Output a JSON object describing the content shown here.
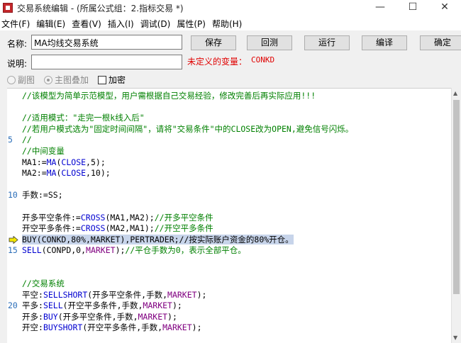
{
  "window": {
    "title": "交易系统编辑 - (所属公式组：2.指标交易 *)",
    "minimize_glyph": "—",
    "maximize_glyph": "☐",
    "close_glyph": "✕"
  },
  "menu": [
    "文件(F)",
    "编辑(E)",
    "查看(V)",
    "插入(I)",
    "调试(D)",
    "属性(P)",
    "帮助(H)"
  ],
  "form": {
    "name_label": "名称:",
    "name_value": "MA均线交易系统",
    "desc_label": "说明:",
    "desc_value": "",
    "undefined_var_label": "未定义的变量：",
    "undefined_var_value": "CONKD",
    "buttons": {
      "save": "保存",
      "rollback": "回测",
      "run": "运行",
      "compile": "编译",
      "confirm": "确定"
    },
    "options": {
      "sub_chart": "副图",
      "main_overlay": "主图叠加",
      "encrypt": "加密",
      "main_overlay_selected": true,
      "encrypt_checked": false
    }
  },
  "editor": {
    "current_line": 14,
    "lines": [
      {
        "n": "",
        "segs": [
          {
            "t": "//该模型为简单示范模型，用户需根据自己交易经验，修改完善后再实际应用!!!",
            "c": "comment"
          }
        ]
      },
      {
        "n": "",
        "segs": []
      },
      {
        "n": "",
        "segs": [
          {
            "t": "//适用模式：\"走完一根k线入后\"",
            "c": "comment"
          }
        ]
      },
      {
        "n": "",
        "segs": [
          {
            "t": "//若用户模式选为\"固定时间间隔\"，请将\"交易条件\"中的CLOSE改为OPEN,避免信号闪烁。",
            "c": "comment"
          }
        ]
      },
      {
        "n": "5",
        "segs": [
          {
            "t": "//",
            "c": "comment"
          }
        ]
      },
      {
        "n": "",
        "segs": [
          {
            "t": "//中间变量",
            "c": "comment"
          }
        ]
      },
      {
        "n": "",
        "segs": [
          {
            "t": "MA1:=",
            "c": ""
          },
          {
            "t": "MA",
            "c": "func"
          },
          {
            "t": "(",
            "c": ""
          },
          {
            "t": "CLOSE",
            "c": "func"
          },
          {
            "t": ",5);",
            "c": ""
          }
        ]
      },
      {
        "n": "",
        "segs": [
          {
            "t": "MA2:=",
            "c": ""
          },
          {
            "t": "MA",
            "c": "func"
          },
          {
            "t": "(",
            "c": ""
          },
          {
            "t": "CLOSE",
            "c": "func"
          },
          {
            "t": ",10);",
            "c": ""
          }
        ]
      },
      {
        "n": "",
        "segs": []
      },
      {
        "n": "10",
        "segs": [
          {
            "t": "手数:=SS;",
            "c": ""
          }
        ]
      },
      {
        "n": "",
        "segs": []
      },
      {
        "n": "",
        "segs": [
          {
            "t": "开多平空条件:=",
            "c": ""
          },
          {
            "t": "CROSS",
            "c": "func"
          },
          {
            "t": "(MA1,MA2);",
            "c": ""
          },
          {
            "t": "//开多平空条件",
            "c": "comment"
          }
        ]
      },
      {
        "n": "",
        "segs": [
          {
            "t": "开空平多条件:=",
            "c": ""
          },
          {
            "t": "CROSS",
            "c": "func"
          },
          {
            "t": "(MA2,MA1);",
            "c": ""
          },
          {
            "t": "//开空平多条件",
            "c": "comment"
          }
        ]
      },
      {
        "n": "",
        "hl": true,
        "segs": [
          {
            "t": "BUY(CONKD,80%,MARKET),PERTRADER;//按实际账户资金的80%开仓。",
            "c": ""
          }
        ]
      },
      {
        "n": "15",
        "segs": [
          {
            "t": "SELL",
            "c": "func"
          },
          {
            "t": "(CONPD,0,",
            "c": ""
          },
          {
            "t": "MARKET",
            "c": "kw"
          },
          {
            "t": ");",
            "c": ""
          },
          {
            "t": "//平仓手数为0，表示全部平仓。",
            "c": "comment"
          }
        ]
      },
      {
        "n": "",
        "segs": []
      },
      {
        "n": "",
        "segs": []
      },
      {
        "n": "",
        "segs": [
          {
            "t": "//交易系统",
            "c": "comment"
          }
        ]
      },
      {
        "n": "",
        "segs": [
          {
            "t": "平空:",
            "c": ""
          },
          {
            "t": "SELLSHORT",
            "c": "func"
          },
          {
            "t": "(开多平空条件,手数,",
            "c": ""
          },
          {
            "t": "MARKET",
            "c": "kw"
          },
          {
            "t": ");",
            "c": ""
          }
        ]
      },
      {
        "n": "20",
        "segs": [
          {
            "t": "平多:",
            "c": ""
          },
          {
            "t": "SELL",
            "c": "func"
          },
          {
            "t": "(开空平多条件,手数,",
            "c": ""
          },
          {
            "t": "MARKET",
            "c": "kw"
          },
          {
            "t": ");",
            "c": ""
          }
        ]
      },
      {
        "n": "",
        "segs": [
          {
            "t": "开多:",
            "c": ""
          },
          {
            "t": "BUY",
            "c": "func"
          },
          {
            "t": "(开多平空条件,手数,",
            "c": ""
          },
          {
            "t": "MARKET",
            "c": "kw"
          },
          {
            "t": ");",
            "c": ""
          }
        ]
      },
      {
        "n": "",
        "segs": [
          {
            "t": "开空:",
            "c": ""
          },
          {
            "t": "BUYSHORT",
            "c": "func"
          },
          {
            "t": "(开空平多条件,手数,",
            "c": ""
          },
          {
            "t": "MARKET",
            "c": "kw"
          },
          {
            "t": ");",
            "c": ""
          }
        ]
      },
      {
        "n": "",
        "segs": []
      }
    ]
  },
  "colors": {
    "comment": "#008000",
    "function": "#0000d0",
    "keyword": "#800080",
    "line_number": "#2a6db8",
    "error_text": "#e00000",
    "highlight": "#c7d4ea",
    "arrow": "#f2e600"
  }
}
